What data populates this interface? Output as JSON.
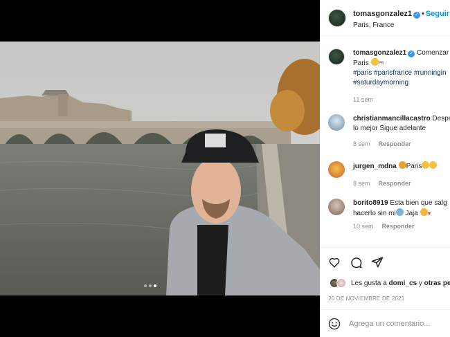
{
  "post": {
    "username": "tomasgonzalez1",
    "verified_badge": "✓",
    "separator": "•",
    "follow_label": "Seguir",
    "location": "Paris, France"
  },
  "caption": {
    "username": "tomasgonzalez1",
    "text_before": "Comenzar",
    "text_city": "Paris",
    "flag_text": "FR",
    "hashtags_line1": "#paris #parisfrance #runningin",
    "hashtags_line2": "#saturdaymorning",
    "time": "11 sem"
  },
  "comments": [
    {
      "username": "christianmancillacastro",
      "text": "Despu",
      "text_line2": "lo mejor Sigue adelante",
      "time": "8 sem",
      "reply_label": "Responder",
      "avatar_color": "#a7c7e0"
    },
    {
      "username": "jurgen_mdna",
      "text": "Paris",
      "time": "8 sem",
      "reply_label": "Responder",
      "avatar_color": "#e8a33d"
    },
    {
      "username": "borito8919",
      "text": "Esta bien que salg",
      "text_line2_a": "hacerlo sin mi",
      "text_line2_b": "Jaja",
      "time": "10 sem",
      "reply_label": "Responder",
      "avatar_color": "#b99a88"
    }
  ],
  "likes": {
    "prefix": "Les gusta a",
    "user": "domi_cs",
    "conj": "y",
    "others": "otras pe"
  },
  "date": "20 DE NOVIEMBRE DE 2021",
  "add_comment_placeholder": "Agrega un comentario...",
  "carousel": {
    "count": 3,
    "active_index": 2
  },
  "colors": {
    "link": "#0095f6",
    "hashtag": "#00376b",
    "muted": "#8e8e8e",
    "text": "#262626",
    "verified": "#3897f0"
  },
  "icons": [
    "heart-icon",
    "comment-icon",
    "share-icon",
    "emoji-icon",
    "verified-icon"
  ]
}
